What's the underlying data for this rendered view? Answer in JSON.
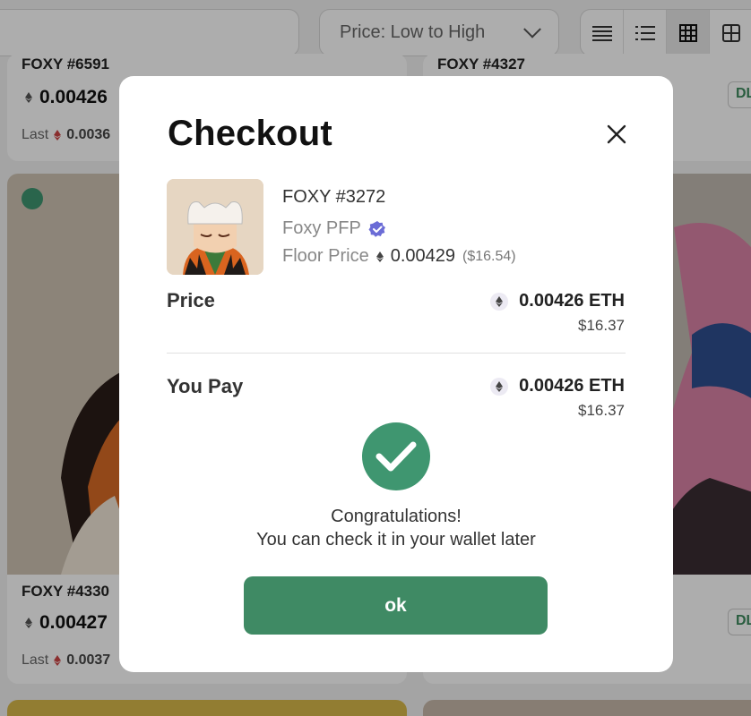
{
  "background": {
    "sort_label": "Price: Low to High",
    "cards": [
      {
        "name": "FOXY #6591",
        "price": "0.00426",
        "last_label": "Last",
        "last_value": "0.0036"
      },
      {
        "name": "FOXY #4327",
        "badge": "DL"
      },
      {
        "name": "FOXY #4330",
        "price": "0.00427",
        "last_label": "Last",
        "last_value": "0.0037"
      },
      {
        "badge": "DL"
      }
    ]
  },
  "modal": {
    "title": "Checkout",
    "item": {
      "name": "FOXY #3272",
      "collection": "Foxy PFP",
      "floor_label": "Floor Price",
      "floor_value": "0.00429",
      "floor_usd": "($16.54)"
    },
    "price": {
      "label": "Price",
      "eth": "0.00426 ETH",
      "usd": "$16.37"
    },
    "you_pay": {
      "label": "You Pay",
      "eth": "0.00426 ETH",
      "usd": "$16.37"
    },
    "message_line1": "Congratulations!",
    "message_line2": "You can check it in your wallet later",
    "ok_label": "ok"
  },
  "colors": {
    "accent": "#3f8a64",
    "success": "#3f9670",
    "verified": "#6b6cd6"
  }
}
